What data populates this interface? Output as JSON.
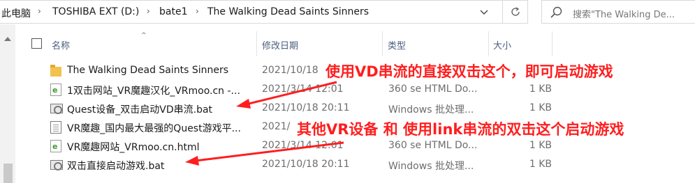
{
  "breadcrumb": {
    "items": [
      "此电脑",
      "TOSHIBA EXT (D:)",
      "bate1",
      "The Walking Dead Saints Sinners"
    ],
    "separator": "›"
  },
  "search": {
    "placeholder": "搜索\"The Walking De..."
  },
  "columns": {
    "name": "名称",
    "date": "修改日期",
    "type": "类型",
    "size": "大小"
  },
  "files": [
    {
      "icon": "folder-icon",
      "name": "The Walking Dead Saints Sinners",
      "date": "2021/10/18",
      "type": "",
      "size": ""
    },
    {
      "icon": "html-file-icon",
      "name": "1双击网站_VR魔趣汉化_VRmoo.cn -...",
      "date": "2021/3/14 12:01",
      "type": "360 se HTML Do...",
      "size": "1 KB"
    },
    {
      "icon": "bat-file-icon",
      "name": "Quest设备_双击启动VD串流.bat",
      "date": "2021/10/18 20:11",
      "type": "Windows 批处理...",
      "size": "1 KB"
    },
    {
      "icon": "text-file-icon",
      "name": "VR魔趣_国内最大最强的Quest游戏平...",
      "date": "2021/",
      "type": "",
      "size": ""
    },
    {
      "icon": "html-file-icon",
      "name": "VR魔趣网站_VRmoo.cn.html",
      "date": "2021/3/14 12:01",
      "type": "360 se HTML Do...",
      "size": "1 KB"
    },
    {
      "icon": "bat-file-icon",
      "name": "双击直接启动游戏.bat",
      "date": "2021/10/18 20:11",
      "type": "Windows 批处理...",
      "size": "1 KB"
    }
  ],
  "annotations": {
    "top": "使用VD串流的直接双击这个，即可启动游戏",
    "bottom": "其他VR设备 和 使用link串流的双击这个启动游戏",
    "color": "#ff1e1e"
  }
}
